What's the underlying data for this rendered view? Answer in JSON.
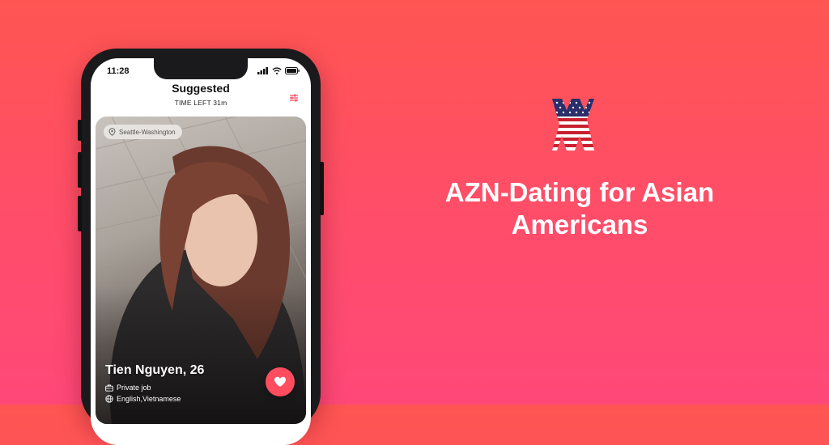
{
  "status_bar": {
    "time": "11:28"
  },
  "header": {
    "title": "Suggested",
    "subtitle": "TIME LEFT 31m"
  },
  "profile": {
    "location": "Seattle-Washington",
    "name_age": "Tien Nguyen, 26",
    "job": "Private job",
    "languages": "English,Vietnamese"
  },
  "tagline": "AZN-Dating for Asian Americans",
  "icons": {
    "location": "location-pin-icon",
    "job": "briefcase-icon",
    "language": "globe-icon",
    "like": "heart-icon",
    "filter": "filter-sliders-icon",
    "logo": "american-flag-xx-logo"
  },
  "colors": {
    "accent": "#ff4d5f",
    "background_top": "#ff5552",
    "background_bottom": "#ff4878"
  }
}
